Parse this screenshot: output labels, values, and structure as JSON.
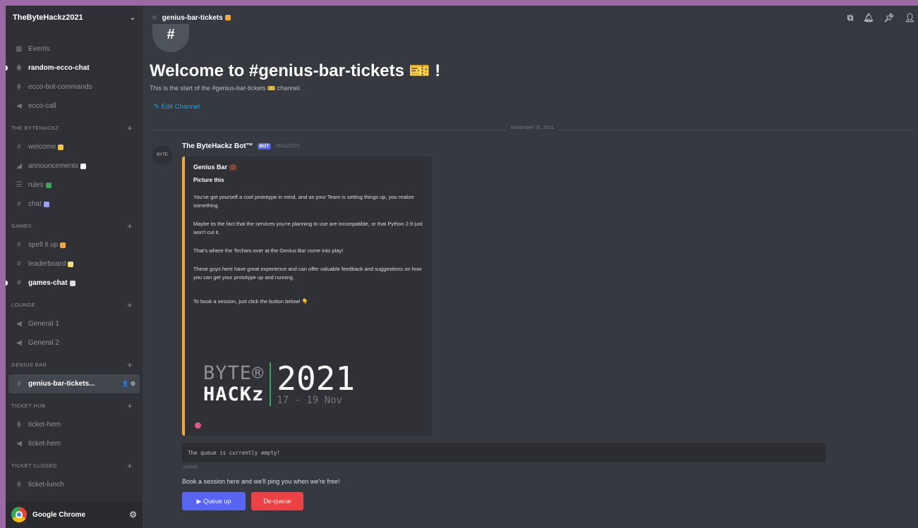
{
  "server": {
    "name": "TheByteHackz2021",
    "chevron_icon": "chevron-down-icon"
  },
  "sidebar": {
    "top_items": [
      {
        "label": "Events",
        "icon": "calendar-icon",
        "state": "normal"
      },
      {
        "label": "random-ecco-chat",
        "icon": "threads-icon",
        "state": "unread"
      },
      {
        "label": "ecco-bot-commands",
        "icon": "threads-icon",
        "state": "normal"
      },
      {
        "label": "ecco-call",
        "icon": "speaker-icon",
        "state": "normal"
      }
    ],
    "categories": [
      {
        "name": "THE BYTEHACKZ",
        "channels": [
          {
            "label": "welcome",
            "icon": "hash-icon",
            "emoji_color": "#f5c242"
          },
          {
            "label": "announcements",
            "icon": "megaphone-icon",
            "emoji_color": "#ffffff"
          },
          {
            "label": "rules",
            "icon": "list-icon",
            "emoji_color": "#3ba55c"
          },
          {
            "label": "chat",
            "icon": "hash-icon",
            "emoji_color": "#9aa0ff"
          }
        ]
      },
      {
        "name": "GAMES",
        "channels": [
          {
            "label": "spell it up",
            "icon": "hash-icon",
            "emoji_color": "#f2a93b"
          },
          {
            "label": "leaderboard",
            "icon": "hash-icon",
            "emoji_color": "#f5e07a"
          },
          {
            "label": "games-chat",
            "icon": "hash-icon",
            "emoji_color": "#dcddde",
            "state": "unread"
          }
        ]
      },
      {
        "name": "LOUNGE",
        "channels": [
          {
            "label": "General 1",
            "icon": "speaker-icon"
          },
          {
            "label": "General 2",
            "icon": "speaker-icon"
          }
        ]
      },
      {
        "name": "GENIUS BAR",
        "channels": [
          {
            "label": "genius-bar-tickets...",
            "icon": "hash-icon",
            "state": "active",
            "right": "👤 ⚙"
          }
        ]
      },
      {
        "name": "TICKET HUB",
        "channels": [
          {
            "label": "ticket-hem",
            "icon": "threads-icon"
          },
          {
            "label": "ticket-hem",
            "icon": "speaker-icon"
          }
        ]
      },
      {
        "name": "TICKET CLOSED",
        "channels": [
          {
            "label": "ticket-lunch",
            "icon": "threads-icon"
          }
        ]
      }
    ]
  },
  "user_panel": {
    "name": "Google Chrome",
    "settings_icon": "gear-icon"
  },
  "header": {
    "channel_name": "genius-bar-tickets",
    "hash_symbol": "#",
    "icons": [
      "threads-icon",
      "bell-icon",
      "pin-icon",
      "members-icon"
    ]
  },
  "welcome": {
    "icon_text": "#",
    "title": "Welcome to #genius-bar-tickets 🎫 !",
    "subtitle": "This is the start of the #genius-bar-tickets 🎫 channel.",
    "edit_label": "✎ Edit Channel"
  },
  "date_divider": "November 16, 2021",
  "message": {
    "avatar_text": "BYTE",
    "author": "The ByteHackz Bot™",
    "bot_tag": "BOT",
    "timestamp": "16/11/2021",
    "embed": {
      "accent_color": "#f2a93b",
      "title": "Genius Bar 💼",
      "subtitle": "Picture this",
      "paragraphs": [
        "You've got yourself a cool prototype in mind, and as your Team is setting things up, you realize something.",
        "Maybe its the fact that the services you're planning to use are incompatible, or that Python 2.9 just won't cut it.",
        "That's where the Techies over at the Genius Bar come into play!",
        "These guys here have great experience and can offer valuable feedback and suggestions on how you can get your prototype up and running.",
        "To book a session, just click the button below! 👇"
      ],
      "logo": {
        "byte": "BYTE®",
        "hackz": "HACKz",
        "year": "2021",
        "dates": "17 - 19 Nov"
      }
    },
    "queue_status": "The queue is currently empty!",
    "edited_label": "(edited)",
    "book_text": "Book a session here and we'll ping you when we're free!",
    "buttons": {
      "queue_up": "▶ Queue up",
      "dequeue": "De-queue"
    }
  }
}
